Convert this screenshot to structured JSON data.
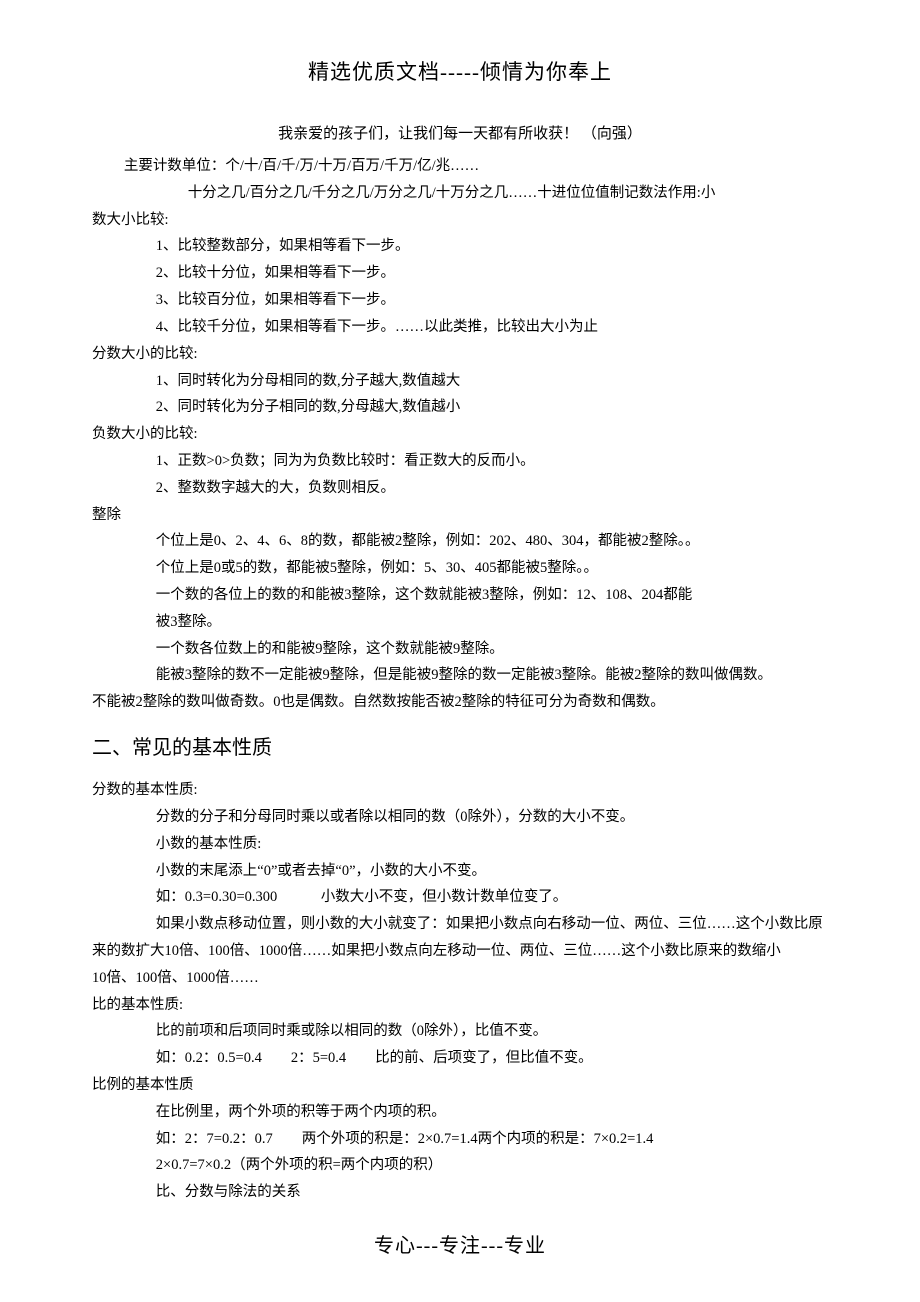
{
  "header": "精选优质文档-----倾情为你奉上",
  "subtitle_main": "我亲爱的孩子们，让我们每一天都有所收获！",
  "subtitle_author": "（向强）",
  "lines": {
    "l1": "主要计数单位：个/十/百/千/万/十万/百万/千万/亿/兆……",
    "l2": "十分之几/百分之几/千分之几/万分之几/十万分之几……十进位位值制记数法作用:小",
    "l3": "数大小比较:",
    "l4": "1、比较整数部分，如果相等看下一步。",
    "l5": "2、比较十分位，如果相等看下一步。",
    "l6": "3、比较百分位，如果相等看下一步。",
    "l7": "4、比较千分位，如果相等看下一步。……以此类推，比较出大小为止",
    "l8": "分数大小的比较:",
    "l9": "1、同时转化为分母相同的数,分子越大,数值越大",
    "l10": "2、同时转化为分子相同的数,分母越大,数值越小",
    "l11": "负数大小的比较:",
    "l12": "1、正数>0>负数；同为为负数比较时：看正数大的反而小。",
    "l13": "2、整数数字越大的大，负数则相反。",
    "l14": "整除",
    "l15": "个位上是0、2、4、6、8的数，都能被2整除，例如：202、480、304，都能被2整除。。",
    "l16": "个位上是0或5的数，都能被5整除，例如：5、30、405都能被5整除。。",
    "l17": "一个数的各位上的数的和能被3整除，这个数就能被3整除，例如：12、108、204都能",
    "l18": "被3整除。",
    "l19": "一个数各位数上的和能被9整除，这个数就能被9整除。",
    "l20": "能被3整除的数不一定能被9整除，但是能被9整除的数一定能被3整除。能被2整除的数叫做偶数。",
    "l21": "不能被2整除的数叫做奇数。0也是偶数。自然数按能否被2整除的特征可分为奇数和偶数。",
    "sec2": "二、常见的基本性质",
    "l22": "分数的基本性质:",
    "l23": "分数的分子和分母同时乘以或者除以相同的数（0除外），分数的大小不变。",
    "l24": "小数的基本性质:",
    "l25": "小数的末尾添上“0”或者去掉“0”，小数的大小不变。",
    "l26": "如：0.3=0.30=0.300　　　小数大小不变，但小数计数单位变了。",
    "l27": "如果小数点移动位置，则小数的大小就变了：如果把小数点向右移动一位、两位、三位……这个小数比原",
    "l28": "来的数扩大10倍、100倍、1000倍……如果把小数点向左移动一位、两位、三位……这个小数比原来的数缩小",
    "l29": "10倍、100倍、1000倍……",
    "l30": "比的基本性质:",
    "l31": "比的前项和后项同时乘或除以相同的数（0除外），比值不变。",
    "l32": "如：0.2：0.5=0.4　　2：5=0.4　　比的前、后项变了，但比值不变。",
    "l33": "比例的基本性质",
    "l34": "在比例里，两个外项的积等于两个内项的积。",
    "l35": "如：2：7=0.2：0.7　　两个外项的积是：2×0.7=1.4两个内项的积是：7×0.2=1.4",
    "l36": "2×0.7=7×0.2（两个外项的积=两个内项的积）",
    "l37": "比、分数与除法的关系"
  },
  "footer": "专心---专注---专业"
}
